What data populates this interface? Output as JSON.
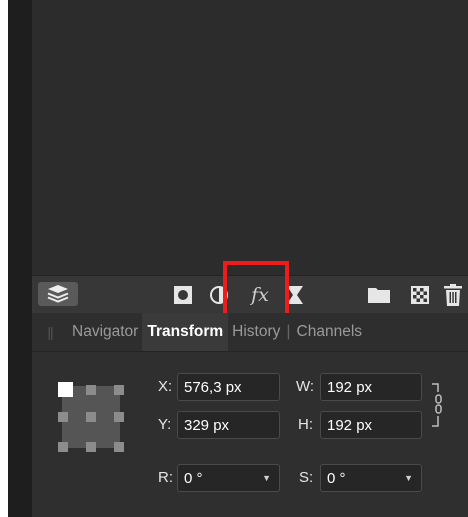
{
  "toolbar": {
    "buttons": [
      {
        "name": "layers-panel-button",
        "icon": "layers-stack-icon"
      },
      {
        "name": "mask-layer-button",
        "icon": "mask-icon"
      },
      {
        "name": "adjustments-button",
        "icon": "adjustment-circle-icon"
      },
      {
        "name": "fx-button",
        "label": "fx",
        "icon": "fx-icon"
      },
      {
        "name": "live-filters-button",
        "icon": "live-filter-icon"
      },
      {
        "name": "group-layers-button",
        "icon": "folder-icon"
      },
      {
        "name": "pixel-layer-button",
        "icon": "checker-icon"
      },
      {
        "name": "delete-layer-button",
        "icon": "trash-icon"
      }
    ],
    "fx_label": "fx",
    "highlight_color": "#ee1d1d"
  },
  "tabs": {
    "items": [
      "Navigator",
      "Transform",
      "History",
      "Channels"
    ],
    "active": "Transform"
  },
  "transform": {
    "x_label": "X:",
    "x_value": "576,3 px",
    "y_label": "Y:",
    "y_value": "329 px",
    "w_label": "W:",
    "w_value": "192 px",
    "h_label": "H:",
    "h_value": "192 px",
    "r_label": "R:",
    "r_value": "0 °",
    "s_label": "S:",
    "s_value": "0 °"
  }
}
